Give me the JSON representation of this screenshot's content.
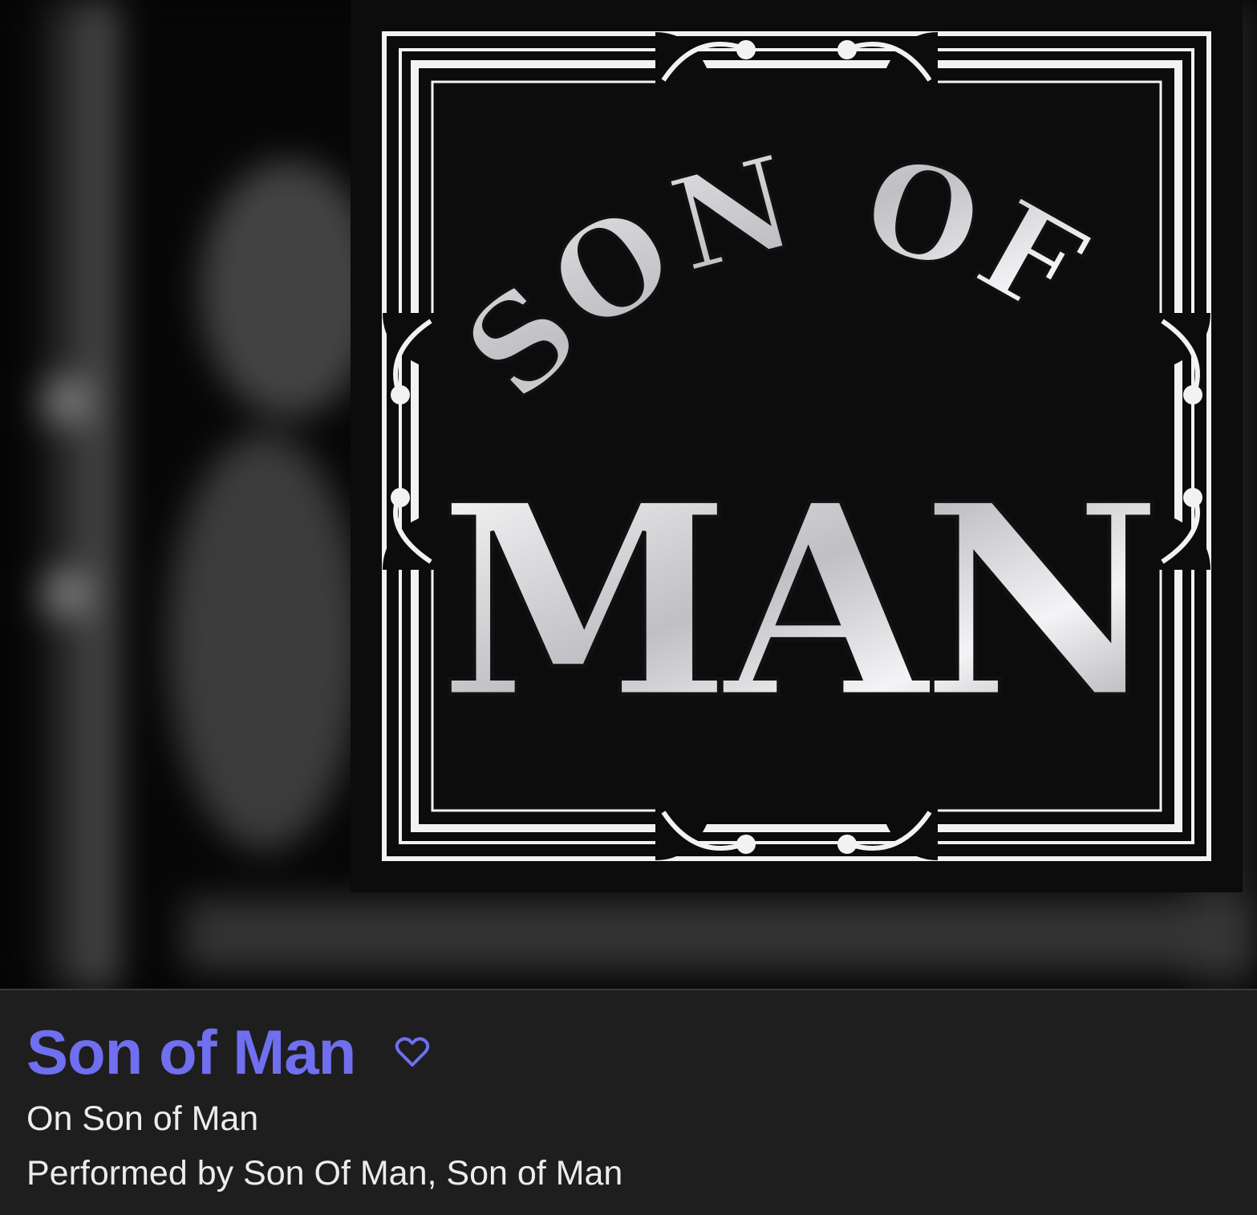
{
  "album_art": {
    "logo_text": "SON OF MAN"
  },
  "track": {
    "title": "Son of Man",
    "album_line": "On Son of Man",
    "performer_line": "Performed by Son Of Man, Son of Man"
  },
  "icons": {
    "favorite": "heart-outline-icon"
  },
  "colors": {
    "title": "#6f6ff0",
    "panel_background": "#1e1e1e",
    "text": "#ececec"
  }
}
